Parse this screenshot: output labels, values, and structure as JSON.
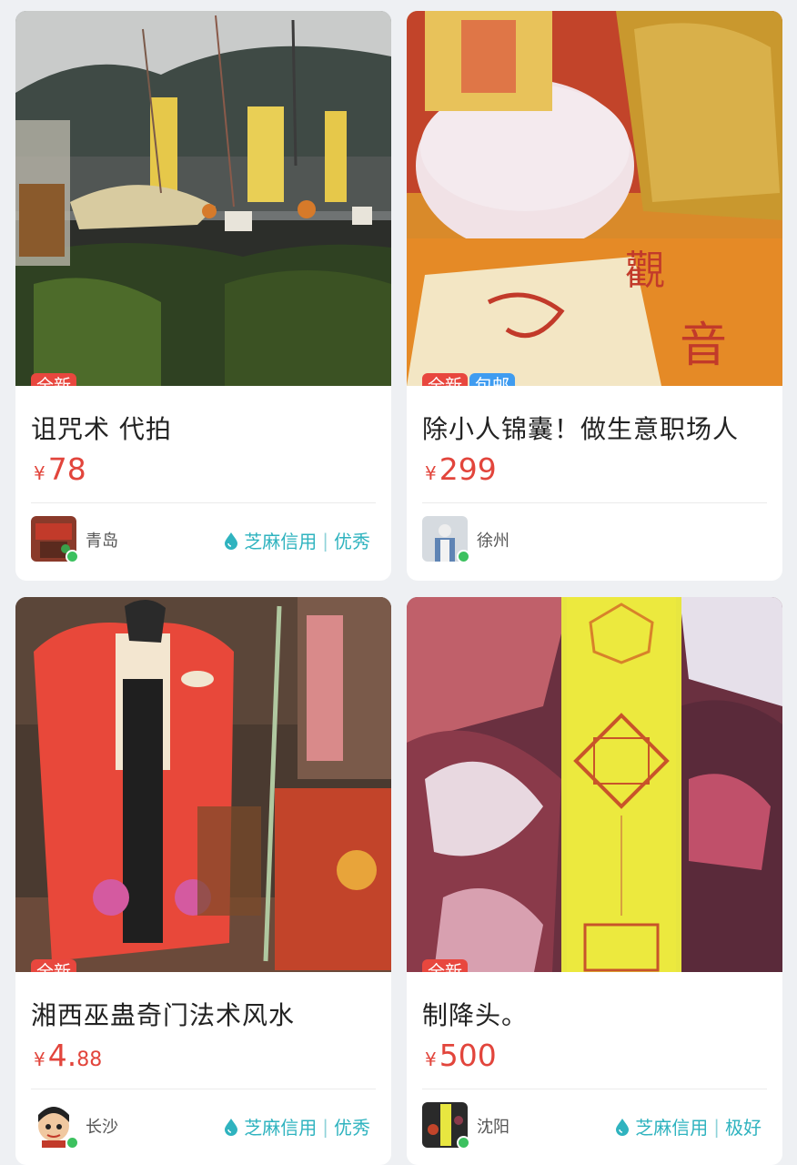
{
  "listings": [
    {
      "badges": [
        "全新"
      ],
      "title": "诅咒术 代拍",
      "currency": "¥",
      "price_int": "78",
      "price_dec": "",
      "city": "青岛",
      "credit_label": "芝麻信用",
      "credit_level": "优秀"
    },
    {
      "badges": [
        "全新",
        "包邮"
      ],
      "title": "除小人锦囊！做生意职场人",
      "currency": "¥",
      "price_int": "299",
      "price_dec": "",
      "city": "徐州",
      "credit_label": "",
      "credit_level": ""
    },
    {
      "badges": [
        "全新"
      ],
      "title": "湘西巫蛊奇门法术风水",
      "currency": "¥",
      "price_int": "4.",
      "price_dec": "88",
      "city": "长沙",
      "credit_label": "芝麻信用",
      "credit_level": "优秀"
    },
    {
      "badges": [
        "全新"
      ],
      "title": "制降头。",
      "currency": "¥",
      "price_int": "500",
      "price_dec": "",
      "city": "沈阳",
      "credit_label": "芝麻信用",
      "credit_level": "极好"
    }
  ],
  "colors": {
    "price": "#e2453c",
    "badge_new": "#e8473e",
    "badge_shipping": "#3f9cf0",
    "credit": "#2fb3bf",
    "online": "#3cc15f"
  },
  "icons": {
    "credit": "sesame-credit-drop-icon",
    "online": "online-status-dot"
  }
}
